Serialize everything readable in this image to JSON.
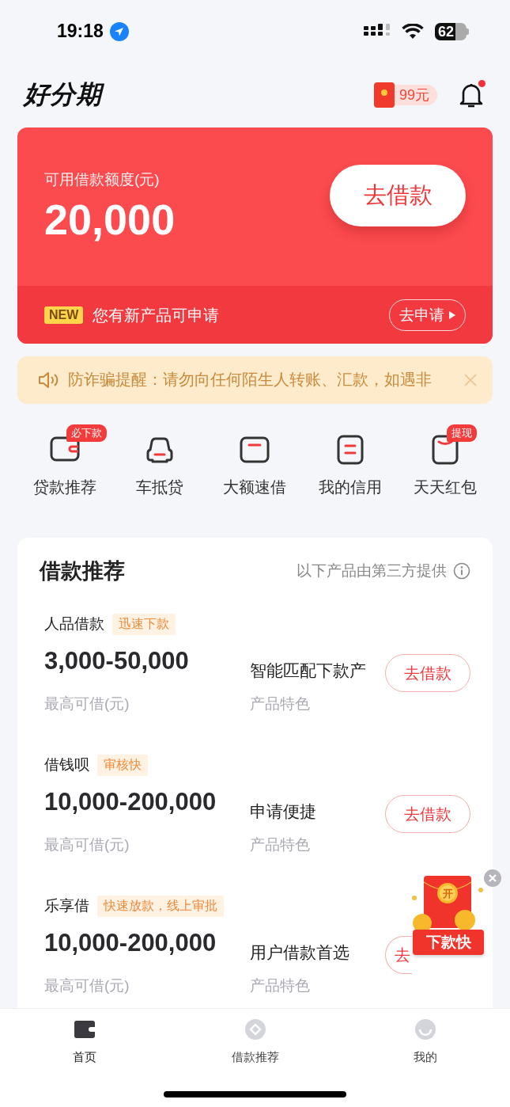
{
  "status_bar": {
    "time": "19:18",
    "battery": "62"
  },
  "header": {
    "logo": "好分期",
    "reward": "99元",
    "notification_dot": true
  },
  "credit_card": {
    "label": "可用借款额度(元)",
    "amount": "20,000",
    "button": "去借款",
    "new_badge": "NEW",
    "message": "您有新产品可申请",
    "apply_button": "去申请"
  },
  "notice": {
    "text": "防诈骗提醒：请勿向任何陌生人转账、汇款，如遇非"
  },
  "shortcuts": [
    {
      "kind": "wallet",
      "label": "贷款推荐",
      "badge": "必下款"
    },
    {
      "kind": "car",
      "label": "车抵贷"
    },
    {
      "kind": "card",
      "label": "大额速借"
    },
    {
      "kind": "doc",
      "label": "我的信用"
    },
    {
      "kind": "envelope",
      "label": "天天红包",
      "badge": "提现"
    }
  ],
  "loans": {
    "title": "借款推荐",
    "note": "以下产品由第三方提供",
    "items": [
      {
        "name": "人品借款",
        "tag": "迅速下款",
        "range": "3,000-50,000",
        "range_label": "最高可借(元)",
        "feature": "智能匹配下款产",
        "feature_label": "产品特色",
        "button": "去借款"
      },
      {
        "name": "借钱呗",
        "tag": "审核快",
        "range": "10,000-200,000",
        "range_label": "最高可借(元)",
        "feature": "申请便捷",
        "feature_label": "产品特色",
        "button": "去借款"
      },
      {
        "name": "乐享借",
        "tag": "快速放款，线上审批",
        "range": "10,000-200,000",
        "range_label": "最高可借(元)",
        "feature": "用户借款首选",
        "feature_label": "产品特色",
        "button": "去"
      }
    ]
  },
  "promo": {
    "seal": "开",
    "label": "下款快"
  },
  "tabs": [
    {
      "kind": "wallet",
      "label": "首页",
      "selected": true
    },
    {
      "kind": "coin",
      "label": "借款推荐",
      "selected": false
    },
    {
      "kind": "smile",
      "label": "我的",
      "selected": false
    }
  ]
}
